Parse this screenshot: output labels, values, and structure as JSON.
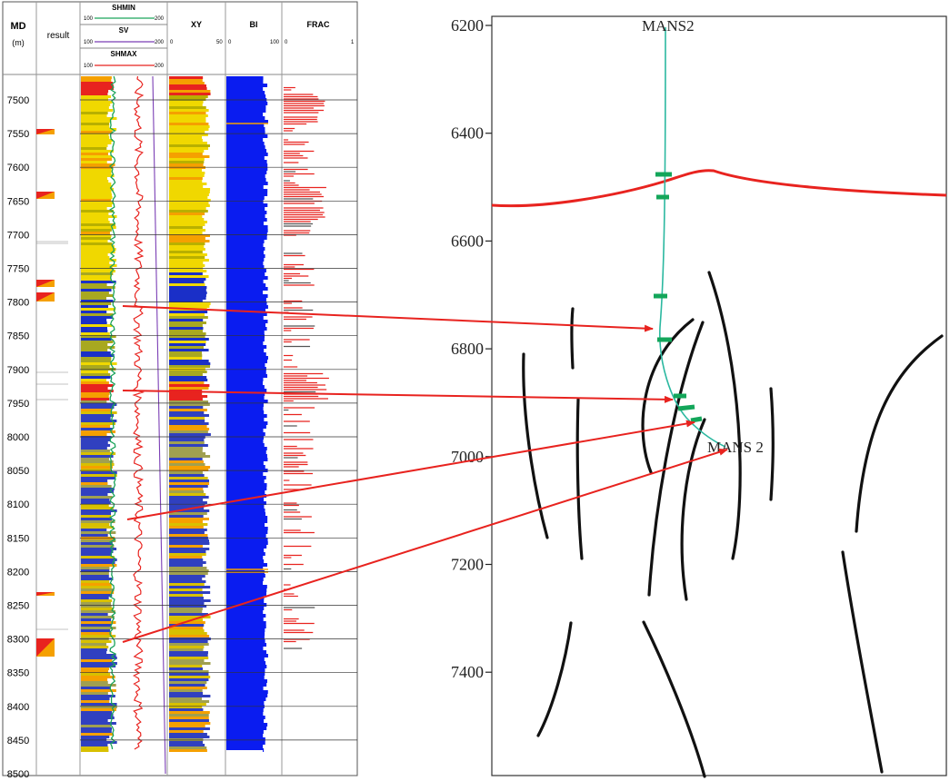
{
  "log_panel": {
    "md_header": "MD",
    "md_unit": "(m)",
    "result_header": "result",
    "tracks": {
      "shmin": {
        "label": "SHMIN",
        "scale_min": "100",
        "scale_max": "200",
        "color": "#1aa35a"
      },
      "sv": {
        "label": "SV",
        "scale_min": "100",
        "scale_max": "200",
        "color": "#7b3fb5"
      },
      "shmax": {
        "label": "SHMAX",
        "scale_min": "100",
        "scale_max": "200",
        "color": "#e8231f"
      },
      "xy": {
        "label": "XY",
        "scale_min": "0",
        "scale_max": "50"
      },
      "bi": {
        "label": "BI",
        "scale_min": "0",
        "scale_max": "100",
        "color": "#0a1cf0"
      },
      "frac": {
        "label": "FRAC",
        "scale_min": "0",
        "scale_max": "1",
        "color": "#e8231f"
      }
    },
    "depth_ticks": [
      "7500",
      "7550",
      "7600",
      "7650",
      "7700",
      "7750",
      "7800",
      "7850",
      "7900",
      "7950",
      "8000",
      "8050",
      "8100",
      "8150",
      "8200",
      "8250",
      "8300",
      "8350",
      "8400",
      "8450",
      "8500"
    ]
  },
  "section_panel": {
    "depth_ticks": [
      "6200",
      "6400",
      "6600",
      "6800",
      "7000",
      "7200",
      "7400"
    ],
    "well_label_top": "MANS2",
    "well_label_bottom": "MANS 2",
    "horizon_color": "#e8231f",
    "well_color": "#2bb8a0"
  },
  "arrows": {
    "color": "#e8231f",
    "count": 4
  }
}
